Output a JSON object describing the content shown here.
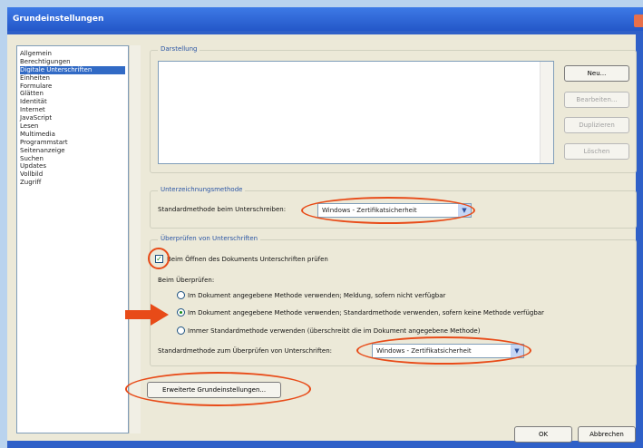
{
  "window": {
    "title": "Grundeinstellungen"
  },
  "categories": {
    "items": [
      "Allgemein",
      "Berechtigungen",
      "Digitale Unterschriften",
      "Einheiten",
      "Formulare",
      "Glätten",
      "Identität",
      "Internet",
      "JavaScript",
      "Lesen",
      "Multimedia",
      "Programmstart",
      "Seitenanzeige",
      "Suchen",
      "Updates",
      "Vollbild",
      "Zugriff"
    ],
    "selected_index": 2
  },
  "darstellung": {
    "title": "Darstellung",
    "buttons": {
      "neu": "Neu...",
      "bearbeiten": "Bearbeiten...",
      "duplizieren": "Duplizieren",
      "loeschen": "Löschen"
    }
  },
  "unterzeichnung": {
    "title": "Unterzeichnungsmethode",
    "label": "Standardmethode beim Unterschreiben:",
    "value": "Windows - Zertifikatsicherheit"
  },
  "ueberpruefen": {
    "title": "Überprüfen von Unterschriften",
    "checkbox_label": "Beim Öffnen des Dokuments Unterschriften prüfen",
    "checkbox_checked": true,
    "beim_label": "Beim Überprüfen:",
    "options": [
      "Im Dokument angegebene Methode verwenden; Meldung, sofern nicht verfügbar",
      "Im Dokument angegebene Methode verwenden; Standardmethode verwenden, sofern keine Methode verfügbar",
      "Immer Standardmethode verwenden (überschreibt die im Dokument angegebene Methode)"
    ],
    "selected_option": 1,
    "method_label": "Standardmethode zum Überprüfen von Unterschriften:",
    "method_value": "Windows - Zertifikatsicherheit"
  },
  "footer": {
    "advanced": "Erweiterte Grundeinstellungen...",
    "ok": "OK",
    "cancel": "Abbrechen"
  },
  "colors": {
    "highlight": "#e84b18",
    "selection": "#316ac5",
    "titlebar": "#2457c8"
  }
}
